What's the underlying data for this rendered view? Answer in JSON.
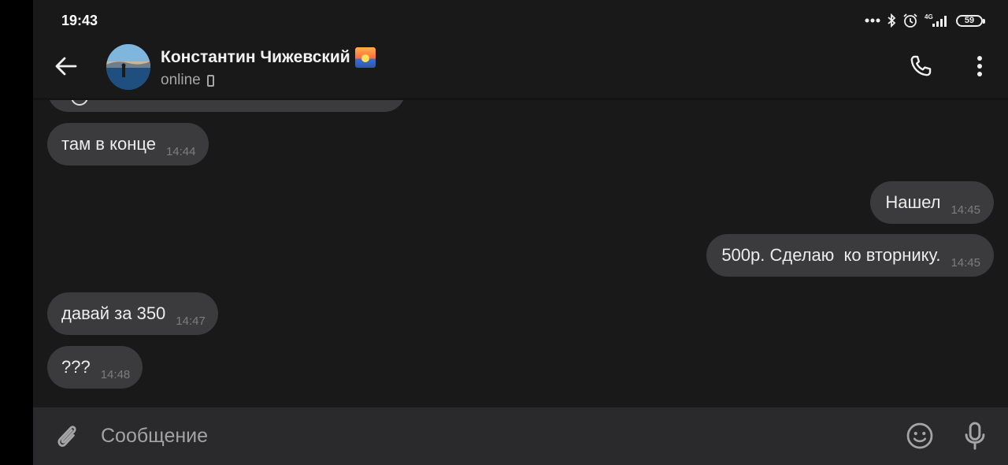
{
  "status_bar": {
    "time": "19:43",
    "network": "4G",
    "battery": "59"
  },
  "header": {
    "contact_name": "Константин Чижевский",
    "presence": "online"
  },
  "messages": [
    {
      "direction": "in",
      "text": "там в конце",
      "time": "14:44"
    },
    {
      "direction": "out",
      "text": "Нашел",
      "time": "14:45"
    },
    {
      "direction": "out",
      "text": "500р. Сделаю  ко вторнику.",
      "time": "14:45"
    },
    {
      "direction": "in",
      "text": "давай за 350",
      "time": "14:47"
    },
    {
      "direction": "in",
      "text": "???",
      "time": "14:48"
    }
  ],
  "composer": {
    "placeholder": "Сообщение"
  },
  "icons": {
    "back": "arrow-left-icon",
    "call": "phone-icon",
    "menu": "more-vertical-icon",
    "attach": "paperclip-icon",
    "emoji": "smile-icon",
    "mic": "microphone-icon"
  }
}
